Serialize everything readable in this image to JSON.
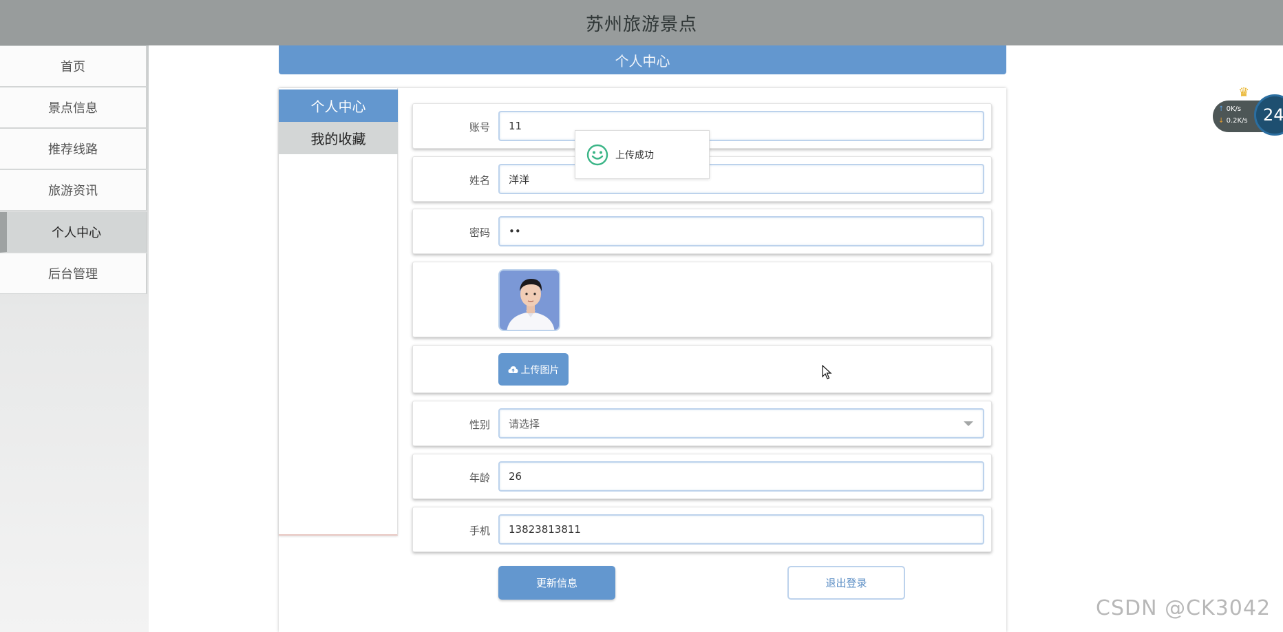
{
  "header": {
    "title": "苏州旅游景点"
  },
  "sidebar": {
    "items": [
      {
        "label": "首页"
      },
      {
        "label": "景点信息"
      },
      {
        "label": "推荐线路"
      },
      {
        "label": "旅游资讯"
      },
      {
        "label": "个人中心",
        "active": true
      },
      {
        "label": "后台管理"
      }
    ]
  },
  "page": {
    "band_title": "个人中心"
  },
  "tabs": [
    {
      "label": "个人中心",
      "active": true
    },
    {
      "label": "我的收藏"
    }
  ],
  "form": {
    "account": {
      "label": "账号",
      "value": "11"
    },
    "name": {
      "label": "姓名",
      "value": "洋洋"
    },
    "password": {
      "label": "密码",
      "value": "••"
    },
    "upload_label": "上传图片",
    "gender": {
      "label": "性别",
      "placeholder": "请选择"
    },
    "age": {
      "label": "年龄",
      "value": "26"
    },
    "phone": {
      "label": "手机",
      "value": "13823813811"
    }
  },
  "actions": {
    "update": "更新信息",
    "logout": "退出登录"
  },
  "toast": {
    "message": "上传成功"
  },
  "net_widget": {
    "up": "0K/s",
    "down": "0.2K/s",
    "circle": "24"
  },
  "watermark": "CSDN @CK3042",
  "colors": {
    "accent": "#6397cf",
    "header": "#989c9c",
    "success": "#3bb587"
  }
}
